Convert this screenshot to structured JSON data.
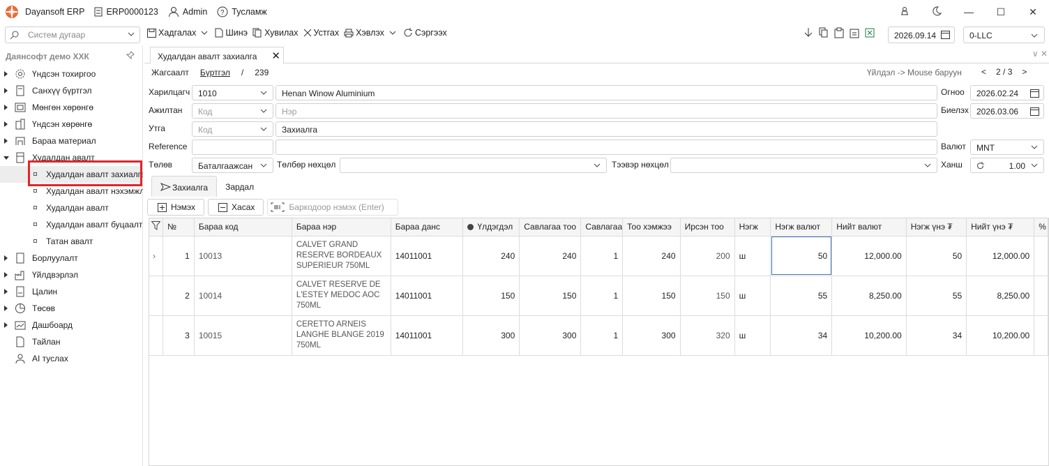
{
  "titlebar": {
    "app_name": "Dayansoft ERP",
    "db_code": "ERP0000123",
    "user": "Admin",
    "help": "Тусламж"
  },
  "toolbar": {
    "search_placeholder": "Систем дугаар",
    "save": "Хадгалах",
    "new": "Шинэ",
    "copy": "Хувилах",
    "delete": "Устгах",
    "print": "Хэвлэх",
    "refresh": "Сэргээх",
    "date": "2026.09.14",
    "company": "0-LLC"
  },
  "sidebar": {
    "title": "Даянсофт демо ХХК",
    "items": [
      {
        "label": "Үндсэн тохиргоо"
      },
      {
        "label": "Санхүү бүртгэл"
      },
      {
        "label": "Мөнгөн хөрөнгө"
      },
      {
        "label": "Үндсэн хөрөнгө"
      },
      {
        "label": "Бараа материал"
      },
      {
        "label": "Худалдан авалт"
      },
      {
        "label": "Худалдан авалт захиалга"
      },
      {
        "label": "Худалдан авалт нэхэмжлэх"
      },
      {
        "label": "Худалдан авалт"
      },
      {
        "label": "Худалдан авалт буцаалт"
      },
      {
        "label": "Татан авалт"
      },
      {
        "label": "Борлуулалт"
      },
      {
        "label": "Үйлдвэрлэл"
      },
      {
        "label": "Цалин"
      },
      {
        "label": "Төсөв"
      },
      {
        "label": "Дашбоард"
      },
      {
        "label": "Тайлан"
      },
      {
        "label": "AI туслах"
      }
    ]
  },
  "doc_tab": {
    "title": "Худалдан авалт захиалга"
  },
  "breadcrumb": {
    "list": "Жагсаалт",
    "register": "Бүртгэл",
    "sep": "/",
    "number": "239"
  },
  "hint": "Үйлдэл -> Mouse баруун",
  "pager": {
    "prev": "<",
    "pos": "2 / 3",
    "next": ">"
  },
  "form": {
    "partner_label": "Харилцагч",
    "partner_code": "1010",
    "partner_name": "Henan Winow Aluminium",
    "employee_label": "Ажилтан",
    "employee_code_ph": "Код",
    "employee_name_ph": "Нэр",
    "note_label": "Утга",
    "note_code_ph": "Код",
    "note_value": "Захиалга",
    "reference_label": "Reference",
    "status_label": "Төлөв",
    "status_value": "Баталгаажсан",
    "payment_label": "Төлбөр нөхцөл",
    "transport_label": "Тээвэр нөхцөл",
    "date_label": "Огноо",
    "date_value": "2026.02.24",
    "delivery_label": "Биелэх",
    "delivery_value": "2026.03.06",
    "currency_label": "Валют",
    "currency_value": "MNT",
    "rate_label": "Ханш",
    "rate_value": "1.00"
  },
  "subtabs": {
    "order": "Захиалга",
    "cost": "Зардал"
  },
  "gridbar": {
    "add": "Нэмэх",
    "remove": "Хасах",
    "barcode_placeholder": "Баркодоор нэмэх (Enter)"
  },
  "grid": {
    "headers": [
      "№",
      "Бараа код",
      "Бараа нэр",
      "Бараа данс",
      "Үлдэгдэл",
      "Савлагаа тоо",
      "Савлагаа",
      "Тоо хэмжээ",
      "Ирсэн тоо",
      "Нэгж",
      "Нэгж валют",
      "Нийт валют",
      "Нэгж үнэ ₮",
      "Нийт үнэ ₮",
      "%"
    ],
    "rows": [
      {
        "no": "1",
        "code": "10013",
        "name": "CALVET GRAND RESERVE BORDEAUX SUPERIEUR 750ML",
        "account": "14011001",
        "stock": "240",
        "pack_qty": "240",
        "pack": "1",
        "qty": "240",
        "received": "200",
        "unit": "ш",
        "unit_cur": "50",
        "total_cur": "12,000.00",
        "unit_price": "50",
        "total_price": "12,000.00"
      },
      {
        "no": "2",
        "code": "10014",
        "name": "CALVET RESERVE DE L'ESTEY MEDOC AOC 750ML",
        "account": "14011001",
        "stock": "150",
        "pack_qty": "150",
        "pack": "1",
        "qty": "150",
        "received": "150",
        "unit": "ш",
        "unit_cur": "55",
        "total_cur": "8,250.00",
        "unit_price": "55",
        "total_price": "8,250.00"
      },
      {
        "no": "3",
        "code": "10015",
        "name": "CERETTO ARNEIS LANGHE BLANGE 2019 750ML",
        "account": "14011001",
        "stock": "300",
        "pack_qty": "300",
        "pack": "1",
        "qty": "300",
        "received": "320",
        "unit": "ш",
        "unit_cur": "34",
        "total_cur": "10,200.00",
        "unit_price": "34",
        "total_price": "10,200.00"
      }
    ]
  }
}
